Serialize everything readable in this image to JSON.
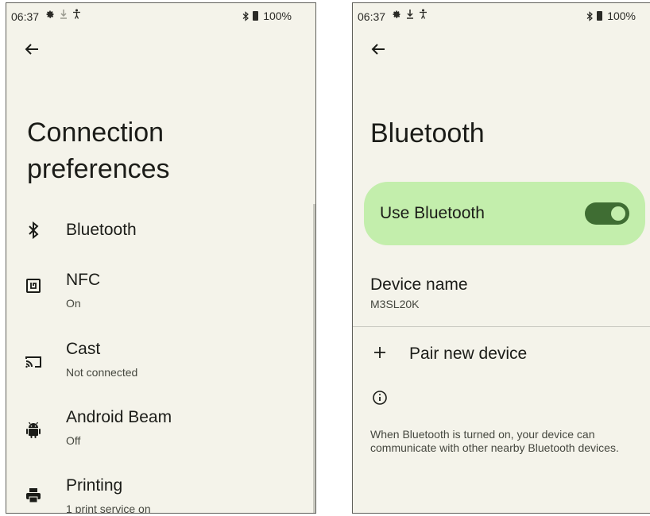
{
  "left": {
    "status": {
      "time": "06:37",
      "battery": "100%"
    },
    "title_lines": [
      "Connection",
      "preferences"
    ],
    "items": [
      {
        "title": "Bluetooth",
        "subtitle": "",
        "icon": "bluetooth-icon"
      },
      {
        "title": "NFC",
        "subtitle": "On",
        "icon": "nfc-icon"
      },
      {
        "title": "Cast",
        "subtitle": "Not connected",
        "icon": "cast-icon"
      },
      {
        "title": "Android Beam",
        "subtitle": "Off",
        "icon": "android-icon"
      },
      {
        "title": "Printing",
        "subtitle": "1 print service on",
        "icon": "printer-icon"
      }
    ]
  },
  "right": {
    "status": {
      "time": "06:37",
      "battery": "100%"
    },
    "title": "Bluetooth",
    "use_bluetooth": {
      "label": "Use Bluetooth",
      "enabled": true
    },
    "device_name": {
      "title": "Device name",
      "value": "M3SL20K"
    },
    "pair_new": "Pair new device",
    "info_text": "When Bluetooth is turned on, your device can communicate with other nearby Bluetooth devices."
  },
  "colors": {
    "background": "#f4f3ea",
    "toggle_on": "#3f6d33",
    "card_highlight": "#c3eeac",
    "text_primary": "#1b1c18",
    "text_secondary": "#45473f"
  }
}
